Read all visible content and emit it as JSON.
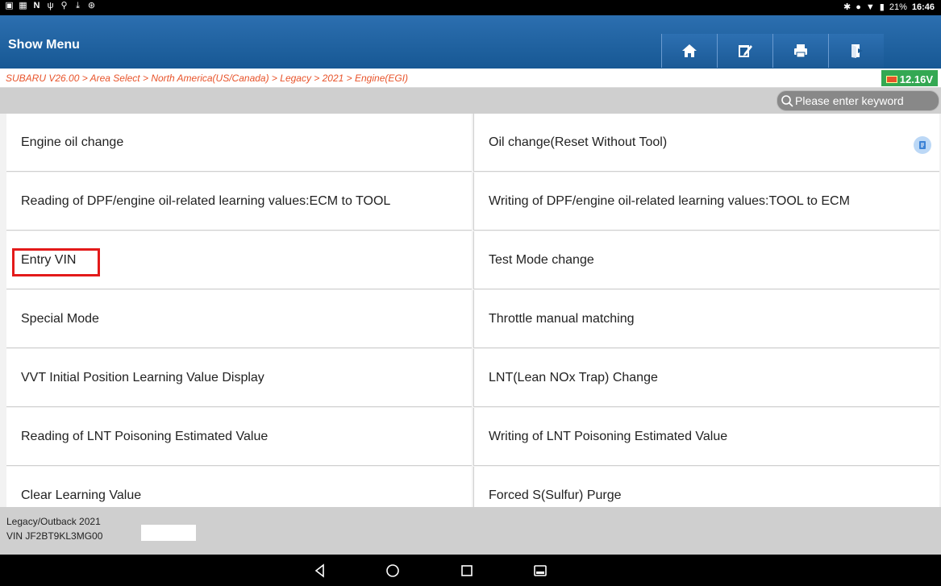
{
  "status_bar": {
    "left_icons": [
      "image-icon",
      "app-icon",
      "n-icon",
      "usb-icon",
      "voice-icon",
      "download-icon",
      "mute-icon"
    ],
    "battery": "21%",
    "time": "16:46"
  },
  "header": {
    "title": "Show Menu",
    "buttons": [
      "home-icon",
      "edit-report-icon",
      "print-icon",
      "exit-icon"
    ]
  },
  "breadcrumb": "SUBARU V26.00 > Area Select > North America(US/Canada) > Legacy > 2021 > Engine(EGI)",
  "voltage": "12.16V",
  "search": {
    "placeholder": "Please enter keyword"
  },
  "menu": [
    [
      "Engine oil change",
      "Oil change(Reset Without Tool)"
    ],
    [
      "Reading of DPF/engine oil-related learning values:ECM to TOOL",
      "Writing of DPF/engine oil-related learning values:TOOL to ECM"
    ],
    [
      "Entry VIN",
      "Test Mode change"
    ],
    [
      "Special Mode",
      "Throttle manual matching"
    ],
    [
      "VVT Initial Position Learning Value Display",
      "LNT(Lean NOx Trap) Change"
    ],
    [
      "Reading of LNT Poisoning Estimated Value",
      "Writing of LNT Poisoning Estimated Value"
    ],
    [
      "Clear Learning Value",
      "Forced S(Sulfur) Purge"
    ]
  ],
  "footer": {
    "vehicle": "Legacy/Outback 2021",
    "vin": "VIN JF2BT9KL3MG00"
  },
  "colors": {
    "header": "#1e5f9d",
    "breadcrumb": "#e8532a",
    "voltage_badge": "#34a853",
    "highlight": "#e31a1a"
  }
}
